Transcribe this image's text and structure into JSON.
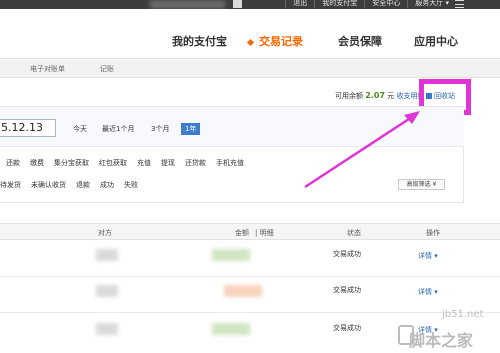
{
  "topbar": {
    "links": [
      "退出",
      "我的支付宝",
      "安全中心",
      "服务大厅 ▾"
    ]
  },
  "nav": {
    "items": [
      {
        "label": "我的支付宝",
        "active": false
      },
      {
        "label": "交易记录",
        "active": true
      },
      {
        "label": "会员保障",
        "active": false
      },
      {
        "label": "应用中心",
        "active": false
      }
    ]
  },
  "subnav": {
    "items": [
      "电子对账单",
      "记账"
    ]
  },
  "balance": {
    "label": "可用余额",
    "amount": "2.07",
    "unit": "元",
    "details_link": "收支明细",
    "recycle_label": "回收站"
  },
  "filter": {
    "date_value": "5.12.13",
    "quick_ranges": [
      "今天",
      "最近1个月",
      "3个月",
      "1年"
    ],
    "selected_range": "1年",
    "types": [
      "还款",
      "缴费",
      "集分宝获取",
      "红包获取",
      "充值",
      "提现",
      "还贷款",
      "手机充值"
    ],
    "statuses": [
      "待发货",
      "未确认收货",
      "退款",
      "成功",
      "失败"
    ],
    "advanced_label": "高级筛选 ¥"
  },
  "table": {
    "headers": {
      "counterparty": "对方",
      "amount": "金额",
      "detail_sep": "| 明细",
      "status": "状态",
      "action": "操作"
    },
    "rows": [
      {
        "status": "交易成功",
        "action": "详情 ▾"
      },
      {
        "status": "交易成功",
        "action": "详情 ▾"
      },
      {
        "status": "交易成功",
        "action": "详情 ▾"
      }
    ]
  },
  "watermark": {
    "site": "jb51.net",
    "name": "脚本之家"
  },
  "colors": {
    "accent": "#ff6600",
    "link": "#2a66b3",
    "highlight": "#e034d6",
    "positive": "#4b8a1c"
  }
}
